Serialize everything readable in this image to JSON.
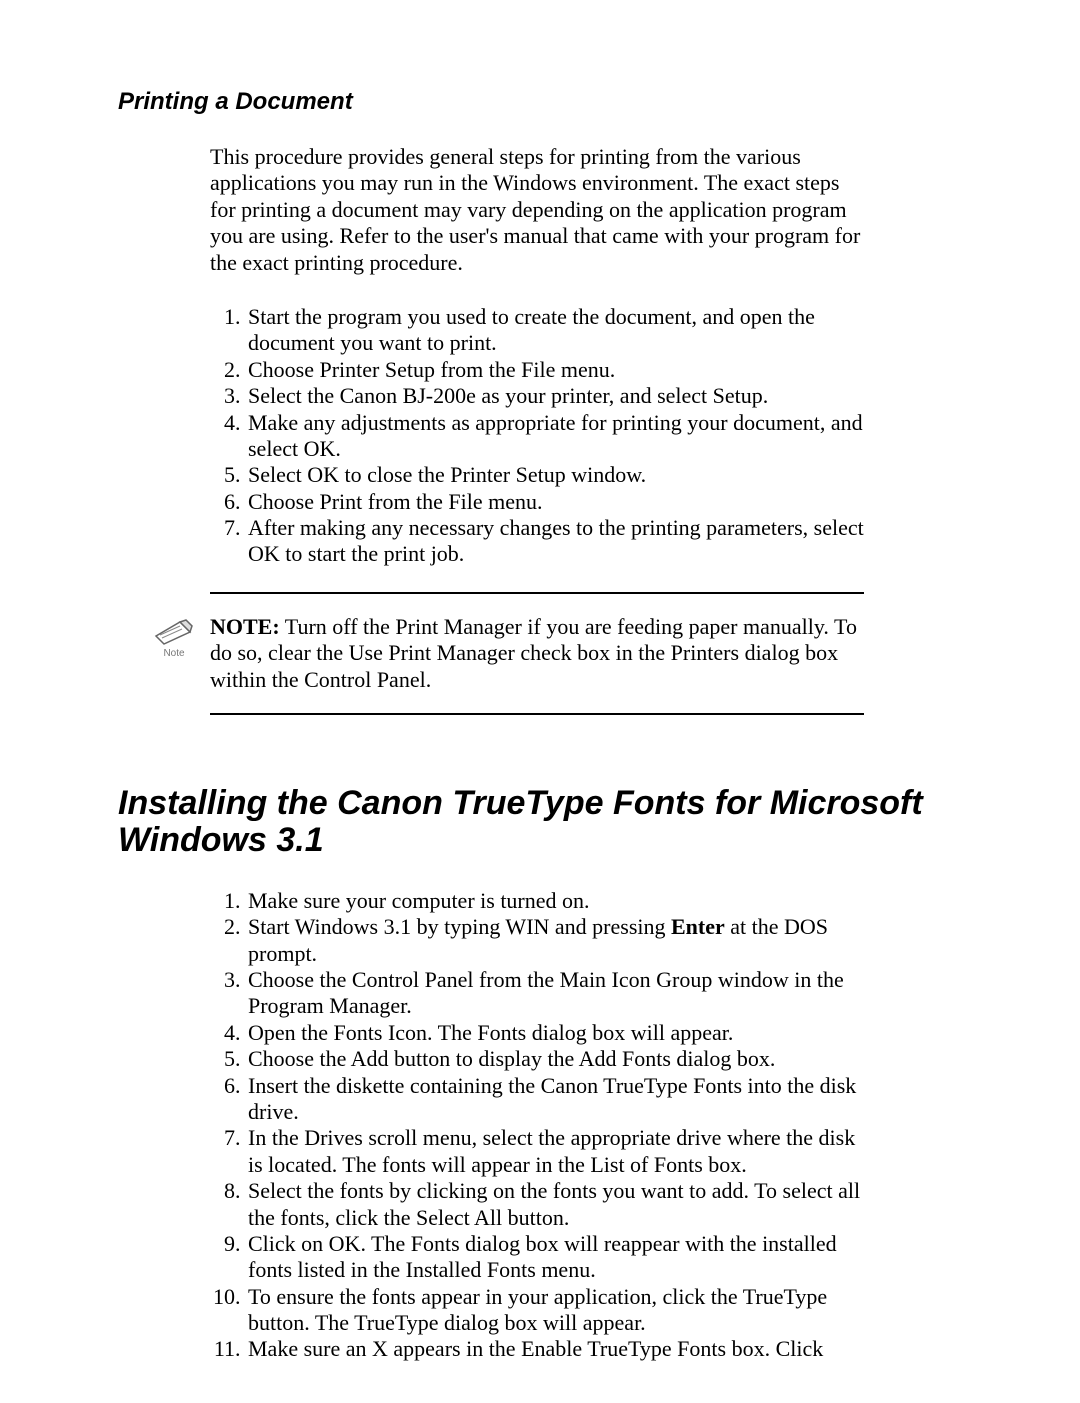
{
  "section1": {
    "heading": "Printing a Document",
    "intro": "This procedure provides general steps for printing from the various applications you may run in the Windows environment. The exact steps for printing a document may vary depending on the application program you are using. Refer to the user's manual that came with your program for the exact printing procedure.",
    "steps": [
      "Start the program you used to create the document, and open the document you want to print.",
      "Choose Printer Setup from the File menu.",
      "Select the Canon BJ-200e as your printer, and select Setup.",
      "Make any adjustments as appropriate for printing your document, and select OK.",
      "Select OK to close the Printer Setup window.",
      "Choose Print from the File menu.",
      "After making any necessary changes to the printing parameters, select OK to start the print job."
    ]
  },
  "note": {
    "icon_label": "Note",
    "label": "NOTE:",
    "text": " Turn off the Print Manager if you are feeding paper manually. To do so, clear the Use Print Manager check box in the Printers dialog box within the Control Panel."
  },
  "section2": {
    "heading": "Installing the Canon TrueType Fonts for Microsoft Windows 3.1",
    "steps_pre": [
      "Make sure your computer is turned on."
    ],
    "step2_a": "Start Windows 3.1 by typing WIN and pressing ",
    "step2_bold": "Enter",
    "step2_b": " at the DOS prompt.",
    "steps_post": [
      "Choose the Control Panel from the Main Icon Group window in the Program Manager.",
      "Open the Fonts Icon. The Fonts dialog box will appear.",
      "Choose the Add button to display the Add Fonts dialog box.",
      "Insert the diskette containing the Canon TrueType Fonts into the disk drive.",
      "In the Drives scroll menu, select the appropriate drive where the disk is located. The fonts will appear in the List of Fonts box.",
      "Select the fonts by clicking on the fonts you want to add. To select all the fonts, click the Select All button.",
      "Click on OK. The Fonts dialog box will reappear with the installed fonts listed in the Installed Fonts menu.",
      "To ensure the fonts appear in your application, click the TrueType button. The TrueType dialog box will appear.",
      "Make sure an X appears in the Enable TrueType Fonts box. Click"
    ]
  }
}
